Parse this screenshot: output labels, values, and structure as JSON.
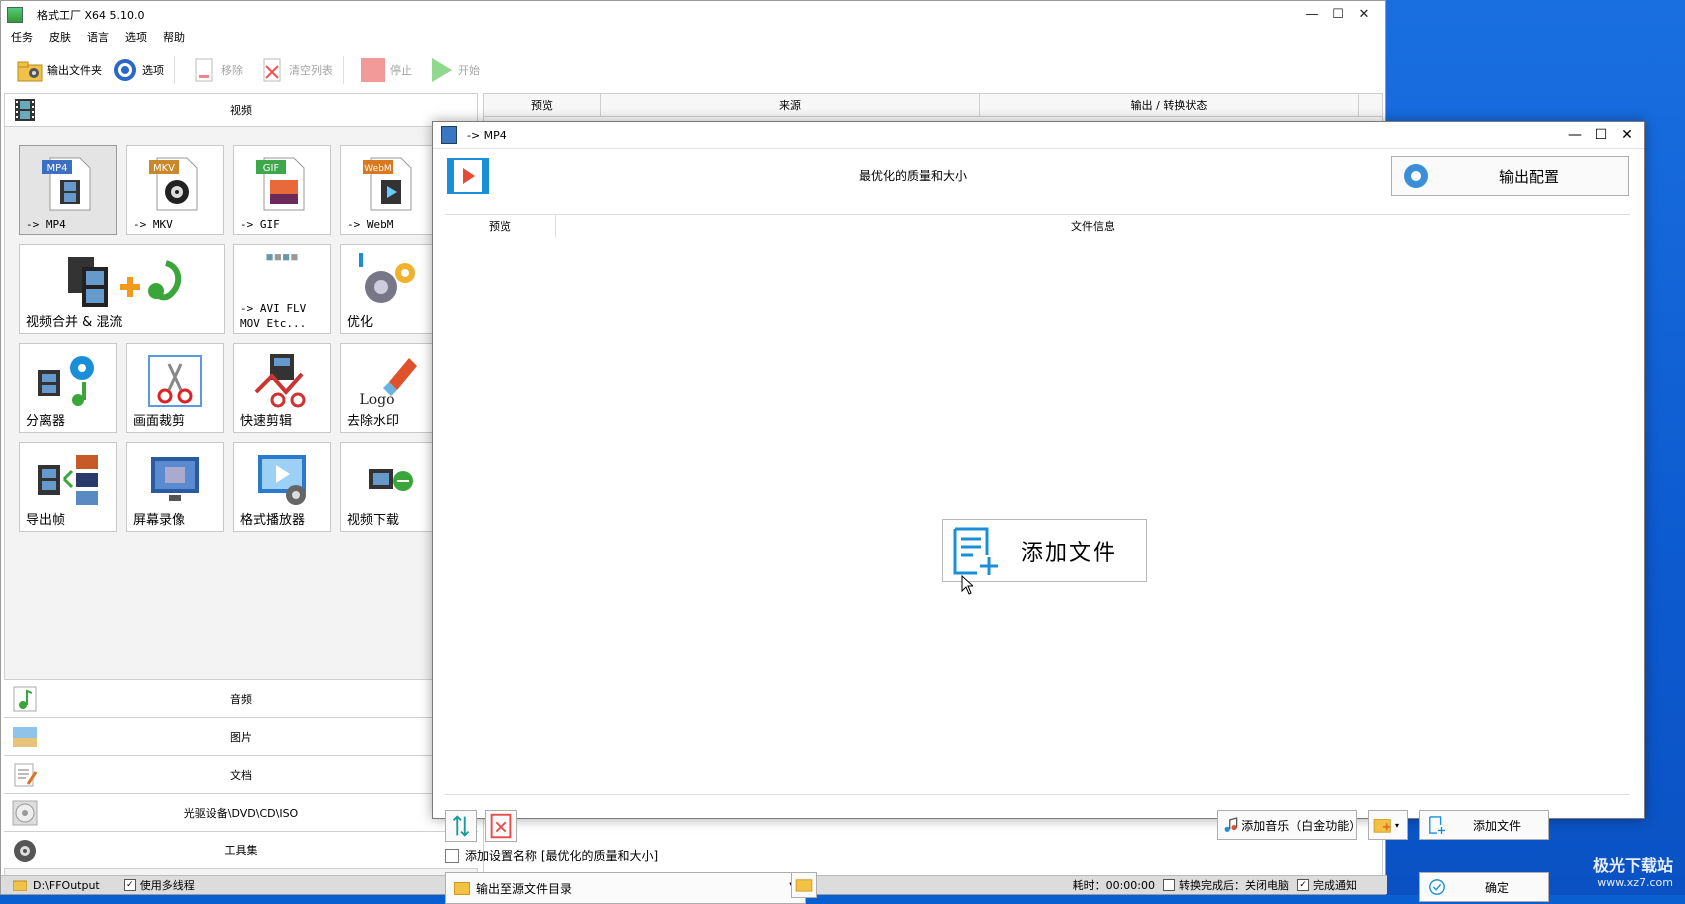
{
  "main": {
    "title": "格式工厂 X64 5.10.0",
    "menu": [
      "任务",
      "皮肤",
      "语言",
      "选项",
      "帮助"
    ],
    "toolbar": {
      "output_folder": "输出文件夹",
      "options": "选项",
      "remove": "移除",
      "clear_list": "清空列表",
      "stop": "停止",
      "start": "开始"
    },
    "categories": {
      "video": "视频",
      "audio": "音频",
      "image": "图片",
      "document": "文档",
      "optical": "光驱设备\\DVD\\CD\\ISO",
      "tools": "工具集"
    },
    "tiles": {
      "mp4": "-> MP4",
      "mkv": "-> MKV",
      "gif": "-> GIF",
      "webm": "-> WebM",
      "merge": "视频合并 & 混流",
      "avi_line1": "-> AVI FLV",
      "avi_line2": "MOV Etc...",
      "optimize": "优化",
      "splitter": "分离器",
      "crop": "画面裁剪",
      "quick_cut": "快速剪辑",
      "remove_logo": "去除水印",
      "export_frames": "导出帧",
      "screen_record": "屏幕录像",
      "player": "格式播放器",
      "download": "视频下载"
    },
    "tile_badges": {
      "mp4": "MP4",
      "mkv": "MKV",
      "gif": "GIF",
      "webm": "WebM",
      "logo": "Logo"
    },
    "task_table": {
      "columns": [
        "预览",
        "来源",
        "输出 / 转换状态"
      ]
    },
    "statusbar": {
      "output_path": "D:\\FFOutput",
      "multithread": "使用多线程",
      "elapsed": "耗时：00:00:00",
      "after_done": "转换完成后：关闭电脑",
      "notify": "完成通知"
    }
  },
  "dialog": {
    "title": "-> MP4",
    "profile": "最优化的质量和大小",
    "output_config": "输出配置",
    "columns": [
      "预览",
      "文件信息"
    ],
    "add_file_big": "添加文件",
    "add_music": "添加音乐（白金功能）",
    "add_file": "添加文件",
    "add_setting_name": "添加设置名称 [最优化的质量和大小]",
    "output_target": "输出至源文件目录",
    "ok": "确定"
  },
  "watermark": {
    "line1": "极光下载站",
    "line2": "www.xz7.com"
  },
  "colors": {
    "accent": "#1a8fd8",
    "desktop": "#0d5bd0"
  }
}
